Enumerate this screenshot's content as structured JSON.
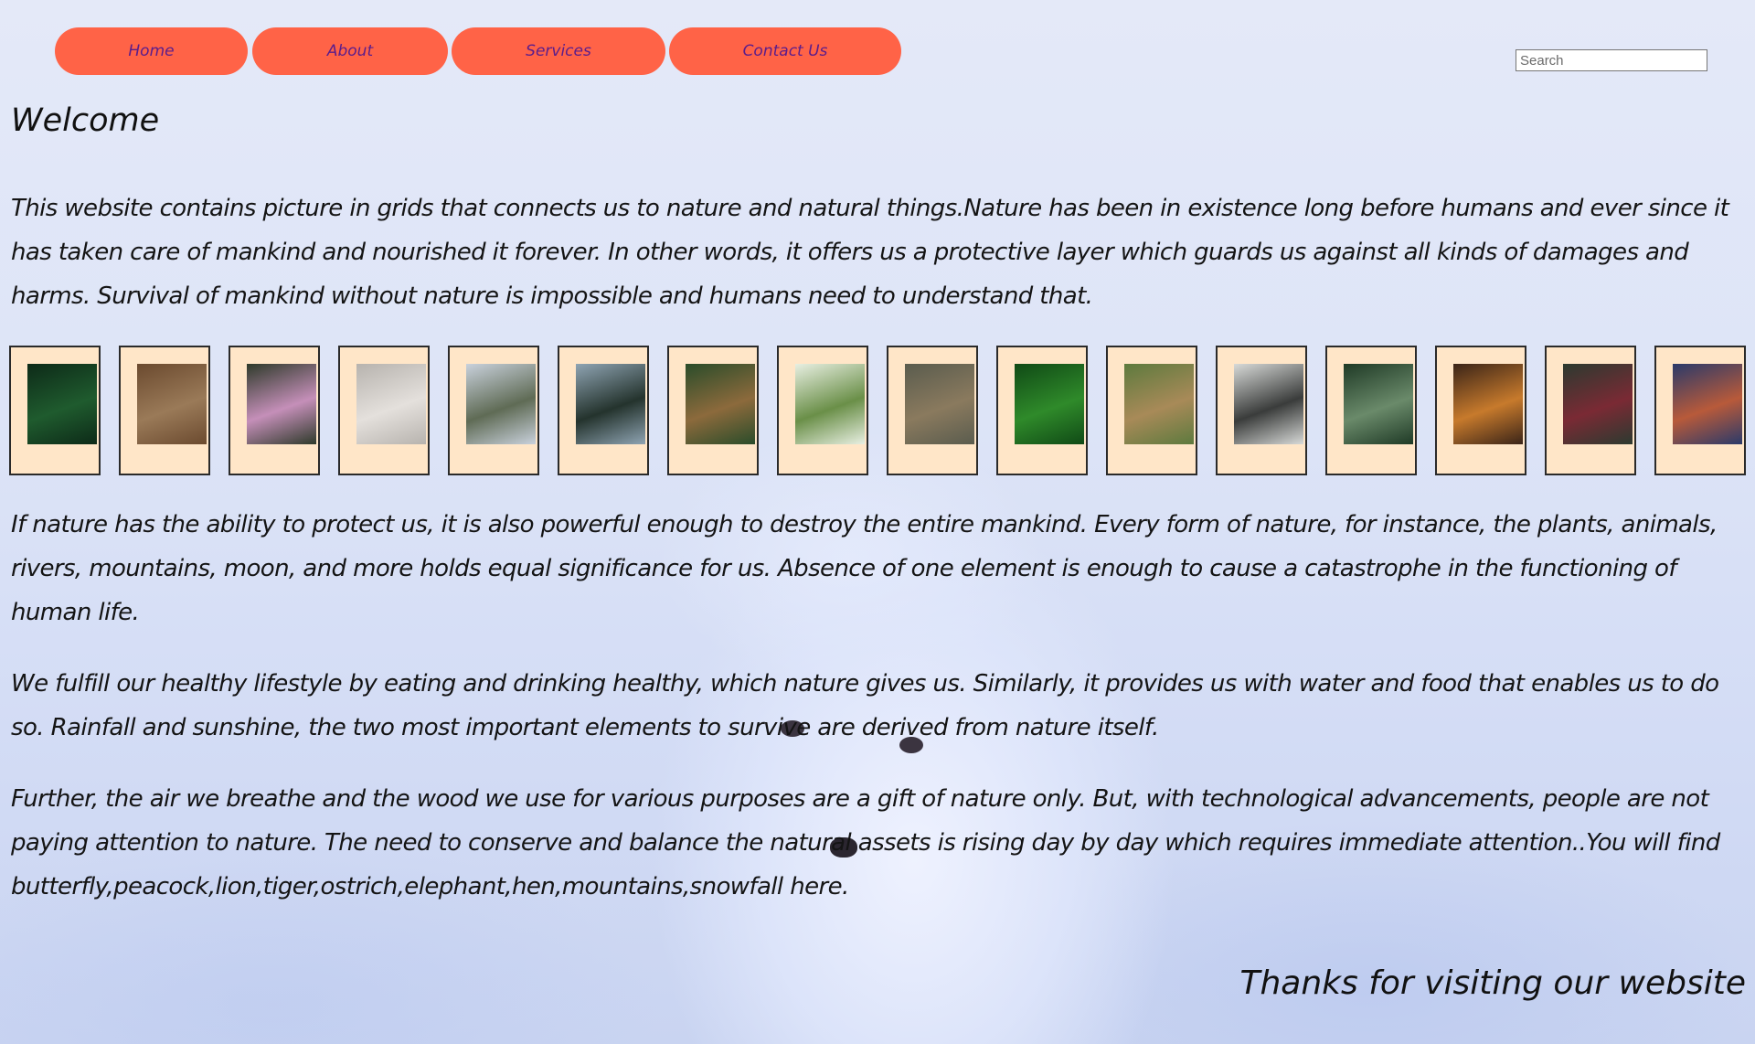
{
  "nav": {
    "items": [
      {
        "label": "Home"
      },
      {
        "label": "About"
      },
      {
        "label": "Services"
      },
      {
        "label": "Contact Us"
      }
    ]
  },
  "search": {
    "placeholder": "Search",
    "value": ""
  },
  "heading": "Welcome",
  "paragraphs": {
    "intro": "This website contains picture in grids that connects us to nature and natural things.Nature has been in existence long before humans and ever since it has taken care of mankind and nourished it forever. In other words, it offers us a protective layer which guards us against all kinds of damages and harms. Survival of mankind without nature is impossible and humans need to understand that.",
    "p2": "If nature has the ability to protect us, it is also powerful enough to destroy the entire mankind. Every form of nature, for instance, the plants, animals, rivers, mountains, moon, and more holds equal significance for us. Absence of one element is enough to cause a catastrophe in the functioning of human life.",
    "p3": "We fulfill our healthy lifestyle by eating and drinking healthy, which nature gives us. Similarly, it provides us with water and food that enables us to do so. Rainfall and sunshine, the two most important elements to survive are derived from nature itself.",
    "p4": "Further, the air we breathe and the wood we use for various purposes are a gift of nature only. But, with technological advancements, people are not paying attention to nature. The need to conserve and balance the natural assets is rising day by day which requires immediate attention..You will find butterfly,peacock,lion,tiger,ostrich,elephant,hen,mountains,snowfall here."
  },
  "gallery": [
    {
      "icon": "leaves-photo",
      "colors": [
        "#0d2a18",
        "#1f5b2e"
      ]
    },
    {
      "icon": "highland-cow-photo",
      "colors": [
        "#6b4a2f",
        "#9a7a58"
      ]
    },
    {
      "icon": "butterfly-flower-photo",
      "colors": [
        "#2e3a2a",
        "#c58fb9"
      ]
    },
    {
      "icon": "misty-birds-photo",
      "colors": [
        "#b7b3ae",
        "#e4e0dc"
      ]
    },
    {
      "icon": "coast-photo",
      "colors": [
        "#c9d1dc",
        "#5f6b55"
      ]
    },
    {
      "icon": "forest-lake-photo",
      "colors": [
        "#8fa4b3",
        "#24332d"
      ]
    },
    {
      "icon": "deer-forest-photo",
      "colors": [
        "#2a4c2a",
        "#8c6a3c"
      ]
    },
    {
      "icon": "bird-branch-photo",
      "colors": [
        "#e8efe2",
        "#6a8f48"
      ]
    },
    {
      "icon": "elephant-photo",
      "colors": [
        "#5a5c4e",
        "#8a7a5e"
      ]
    },
    {
      "icon": "fern-photo",
      "colors": [
        "#104a16",
        "#2f8a2a"
      ]
    },
    {
      "icon": "deer-meadow-photo",
      "colors": [
        "#5d7a3e",
        "#a88a58"
      ]
    },
    {
      "icon": "snowy-river-photo",
      "colors": [
        "#d8dad8",
        "#3a3c3b"
      ]
    },
    {
      "icon": "pine-forest-photo",
      "colors": [
        "#1f3a26",
        "#6a8a6a"
      ]
    },
    {
      "icon": "sunset-water-photo",
      "colors": [
        "#3a2418",
        "#c77a2c"
      ]
    },
    {
      "icon": "hiker-woods-photo",
      "colors": [
        "#2c3a30",
        "#7a2a34"
      ]
    },
    {
      "icon": "parrot-photo",
      "colors": [
        "#2a3a6a",
        "#b85a3a"
      ]
    }
  ],
  "thanks": "Thanks for visiting our website",
  "colors": {
    "nav_bg": "#ff6347",
    "nav_text": "#5a1d8c",
    "frame_bg": "#ffe6c8"
  }
}
